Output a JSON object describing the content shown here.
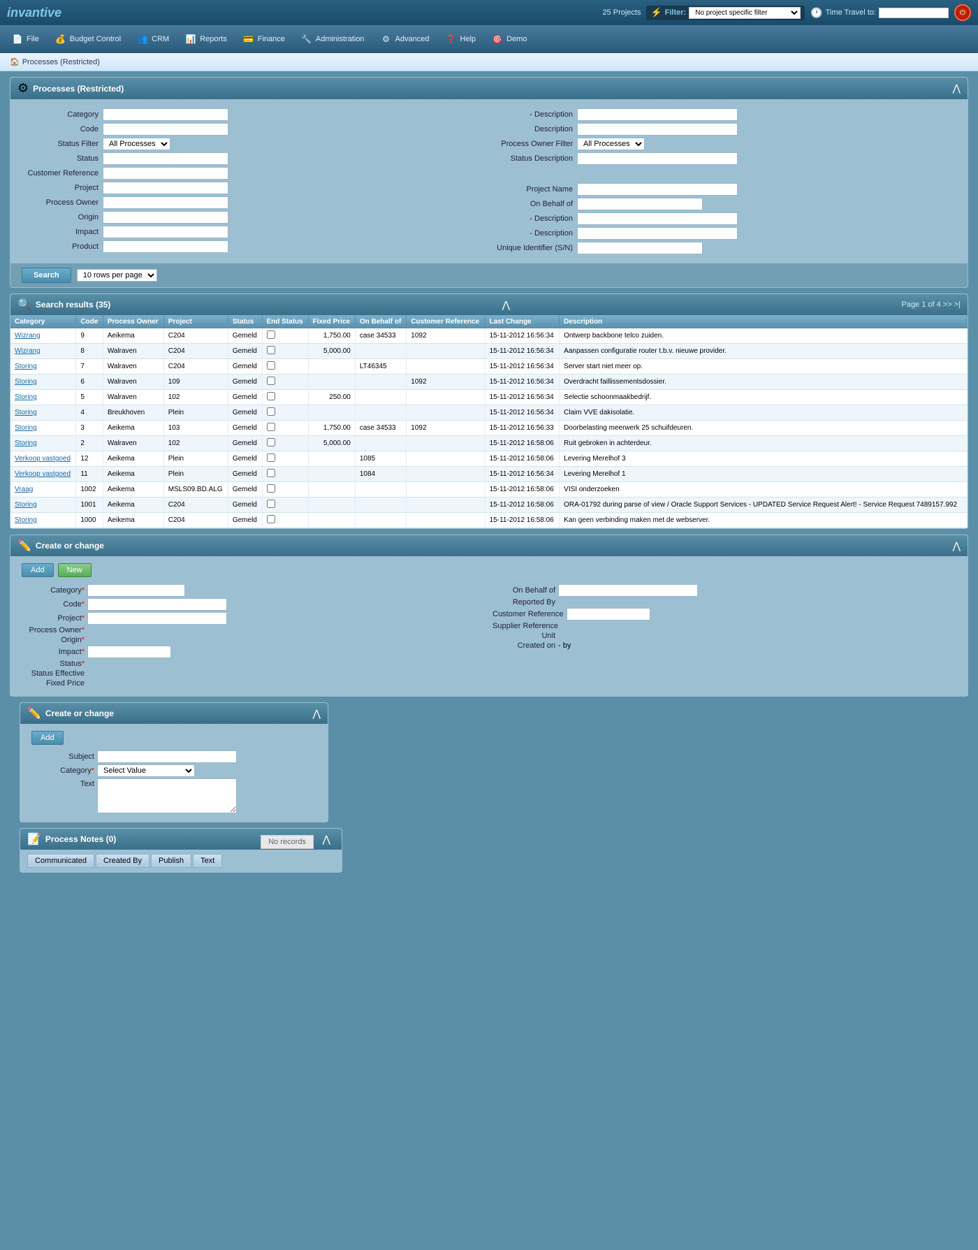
{
  "app": {
    "logo": "invantive",
    "projects_count": "25 Projects",
    "filter_label": "Filter:",
    "filter_placeholder": "No project specific filter",
    "time_travel_label": "Time Travel to:",
    "time_travel_value": ""
  },
  "nav": {
    "items": [
      {
        "id": "file",
        "label": "File",
        "icon": "📄"
      },
      {
        "id": "budget-control",
        "label": "Budget Control",
        "icon": "💰"
      },
      {
        "id": "crm",
        "label": "CRM",
        "icon": "👥"
      },
      {
        "id": "reports",
        "label": "Reports",
        "icon": "📊"
      },
      {
        "id": "finance",
        "label": "Finance",
        "icon": "💳"
      },
      {
        "id": "administration",
        "label": "Administration",
        "icon": "🔧"
      },
      {
        "id": "advanced",
        "label": "Advanced",
        "icon": "⚙"
      },
      {
        "id": "help",
        "label": "Help",
        "icon": "❓"
      },
      {
        "id": "demo",
        "label": "Demo",
        "icon": "🎯"
      }
    ]
  },
  "breadcrumb": {
    "home_label": "Processes (Restricted)"
  },
  "search_form": {
    "title": "Processes (Restricted)",
    "fields": {
      "category_label": "Category",
      "description_label": "- Description",
      "code_label": "Code",
      "description2_label": "Description",
      "status_filter_label": "Status Filter",
      "status_filter_value": "All Processes",
      "process_owner_filter_label": "Process Owner Filter",
      "process_owner_filter_value": "All Processes",
      "status_label": "Status",
      "status_description_label": "Status Description",
      "customer_reference_label": "Customer Reference",
      "project_label": "Project",
      "project_name_label": "Project Name",
      "process_owner_label": "Process Owner",
      "on_behalf_of_label": "On Behalf of",
      "origin_label": "Origin",
      "origin_desc_label": "- Description",
      "impact_label": "Impact",
      "impact_desc_label": "- Description",
      "product_label": "Product",
      "unique_id_label": "Unique Identifier (S/N)"
    },
    "search_button": "Search",
    "rows_label": "10 rows per page"
  },
  "search_results": {
    "title": "Search results (35)",
    "pagination": "Page 1 of 4 >> >|",
    "columns": [
      "Category",
      "Code",
      "Process Owner",
      "Project",
      "Status",
      "End Status",
      "Fixed Price",
      "On Behalf of",
      "Customer Reference",
      "Last Change",
      "Description"
    ],
    "rows": [
      {
        "category": "Wizrang",
        "code": "9",
        "owner": "Aeikema",
        "project": "C204",
        "status": "Gemeld",
        "end_status": "",
        "fixed": "1,750.00",
        "behalf": "case 34533",
        "customer": "1092",
        "last_change": "15-11-2012 16:56:34",
        "description": "Ontwerp backbone telco zuiden."
      },
      {
        "category": "Wizrang",
        "code": "8",
        "owner": "Walraven",
        "project": "C204",
        "status": "Gemeld",
        "end_status": "",
        "fixed": "5,000.00",
        "behalf": "",
        "customer": "",
        "last_change": "15-11-2012 16:56:34",
        "description": "Aanpassen configuratie router t.b.v. nieuwe provider."
      },
      {
        "category": "Storing",
        "code": "7",
        "owner": "Walraven",
        "project": "C204",
        "status": "Gemeld",
        "end_status": "",
        "fixed": "",
        "behalf": "LT46345",
        "customer": "",
        "last_change": "15-11-2012 16:56:34",
        "description": "Server start niet meer op."
      },
      {
        "category": "Storing",
        "code": "6",
        "owner": "Walraven",
        "project": "109",
        "status": "Gemeld",
        "end_status": "",
        "fixed": "",
        "behalf": "",
        "customer": "1092",
        "last_change": "15-11-2012 16:56:34",
        "description": "Overdracht faillissementsdossier."
      },
      {
        "category": "Storing",
        "code": "5",
        "owner": "Walraven",
        "project": "102",
        "status": "Gemeld",
        "end_status": "",
        "fixed": "250.00",
        "behalf": "",
        "customer": "",
        "last_change": "15-11-2012 16:56:34",
        "description": "Selectie schoonmaakbedrijf."
      },
      {
        "category": "Storing",
        "code": "4",
        "owner": "Breukhoven",
        "project": "Plein",
        "status": "Gemeld",
        "end_status": "",
        "fixed": "",
        "behalf": "",
        "customer": "",
        "last_change": "15-11-2012 16:56:34",
        "description": "Claim VVE dakisolatie."
      },
      {
        "category": "Storing",
        "code": "3",
        "owner": "Aeikema",
        "project": "103",
        "status": "Gemeld",
        "end_status": "",
        "fixed": "1,750.00",
        "behalf": "case 34533",
        "customer": "1092",
        "last_change": "15-11-2012 16:56:33",
        "description": "Doorbelasting meerwerk 25 schuifdeuren."
      },
      {
        "category": "Storing",
        "code": "2",
        "owner": "Walraven",
        "project": "102",
        "status": "Gemeld",
        "end_status": "",
        "fixed": "5,000.00",
        "behalf": "",
        "customer": "",
        "last_change": "15-11-2012 16:58:06",
        "description": "Ruit gebroken in achterdeur."
      },
      {
        "category": "Verkoop vastgoed",
        "code": "12",
        "owner": "Aeikema",
        "project": "Plein",
        "status": "Gemeld",
        "end_status": "",
        "fixed": "",
        "behalf": "1085",
        "customer": "",
        "last_change": "15-11-2012 16:58:06",
        "description": "Levering Merelhof 3"
      },
      {
        "category": "Verkoop vastgoed",
        "code": "11",
        "owner": "Aeikema",
        "project": "Plein",
        "status": "Gemeld",
        "end_status": "",
        "fixed": "",
        "behalf": "1084",
        "customer": "",
        "last_change": "15-11-2012 16:56:34",
        "description": "Levering Merelhof 1"
      },
      {
        "category": "Vraag",
        "code": "1002",
        "owner": "Aeikema",
        "project": "MSLS09.BD.ALG",
        "status": "Gemeld",
        "end_status": "",
        "fixed": "",
        "behalf": "",
        "customer": "",
        "last_change": "15-11-2012 16:58:06",
        "description": "VISI onderzoeken"
      },
      {
        "category": "Storing",
        "code": "1001",
        "owner": "Aeikema",
        "project": "C204",
        "status": "Gemeld",
        "end_status": "",
        "fixed": "",
        "behalf": "",
        "customer": "",
        "last_change": "15-11-2012 16:58:06",
        "description": "ORA-01792 during parse of view / Oracle Support Services - UPDATED Service Request Alert! - Service Request 7489157.992"
      },
      {
        "category": "Storing",
        "code": "1000",
        "owner": "Aeikema",
        "project": "C204",
        "status": "Gemeld",
        "end_status": "",
        "fixed": "",
        "behalf": "",
        "customer": "",
        "last_change": "15-11-2012 16:58:06",
        "description": "Kan geen verbinding maken met de webserver."
      }
    ]
  },
  "create_change": {
    "title": "Create or change",
    "add_button": "Add",
    "new_button": "New",
    "fields": {
      "category_label": "Category",
      "code_label": "Code",
      "project_label": "Project",
      "process_owner_label": "Process Owner",
      "on_behalf_of_label": "On Behalf of",
      "reported_by_label": "Reported By",
      "origin_label": "Origin",
      "impact_label": "Impact",
      "customer_reference_label": "Customer Reference",
      "status_label": "Status",
      "supplier_reference_label": "Supplier Reference",
      "status_effective_label": "Status Effective",
      "unit_label": "Unit",
      "fixed_price_label": "Fixed Price",
      "created_on_label": "Created on",
      "created_by_value": "- by"
    }
  },
  "create_change2": {
    "title": "Create or change",
    "add_button": "Add",
    "fields": {
      "subject_label": "Subject",
      "category_label": "Category",
      "category_placeholder": "Select Value",
      "text_label": "Text"
    }
  },
  "process_notes": {
    "title": "Process Notes (0)",
    "no_records": "No records",
    "tabs": [
      "Communicated",
      "Created By",
      "Publish",
      "Text"
    ]
  }
}
